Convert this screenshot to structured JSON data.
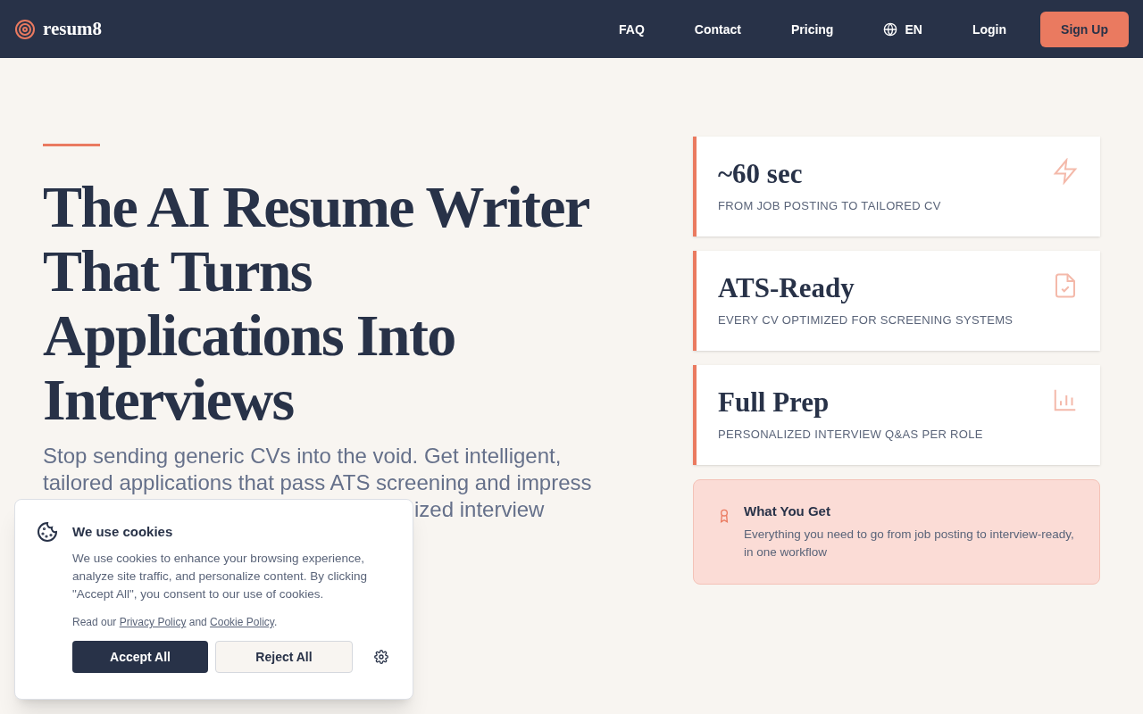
{
  "nav": {
    "brand": "resum8",
    "links": [
      "FAQ",
      "Contact",
      "Pricing"
    ],
    "language": "EN",
    "login": "Login",
    "signup": "Sign Up"
  },
  "hero": {
    "headline": "The AI Resume Writer That Turns Applications Into Interviews",
    "subtitle_lines": [
      "Stop sending generic CVs into the void. Get intelligent,",
      "tailored applications that pass ATS screening and impress"
    ],
    "subtitle_fragment": "ized interview"
  },
  "stats": [
    {
      "value": "~60 sec",
      "caption": "FROM JOB POSTING TO TAILORED CV"
    },
    {
      "value": "ATS-Ready",
      "caption": "EVERY CV OPTIMIZED FOR SCREENING SYSTEMS"
    },
    {
      "value": "Full Prep",
      "caption": "PERSONALIZED INTERVIEW Q&AS PER ROLE"
    }
  ],
  "benefit": {
    "title": "What You Get",
    "text": "Everything you need to go from job posting to interview-ready, in one workflow"
  },
  "cookie_banner": {
    "title": "We use cookies",
    "text": "We use cookies to enhance your browsing experience, analyze site traffic, and personalize content. By clicking \"Accept All\", you consent to our use of cookies.",
    "read_prefix": "Read our",
    "privacy_link": "Privacy Policy",
    "and": "and",
    "cookie_link": "Cookie Policy",
    "period": ".",
    "accept": "Accept All",
    "reject": "Reject All"
  }
}
